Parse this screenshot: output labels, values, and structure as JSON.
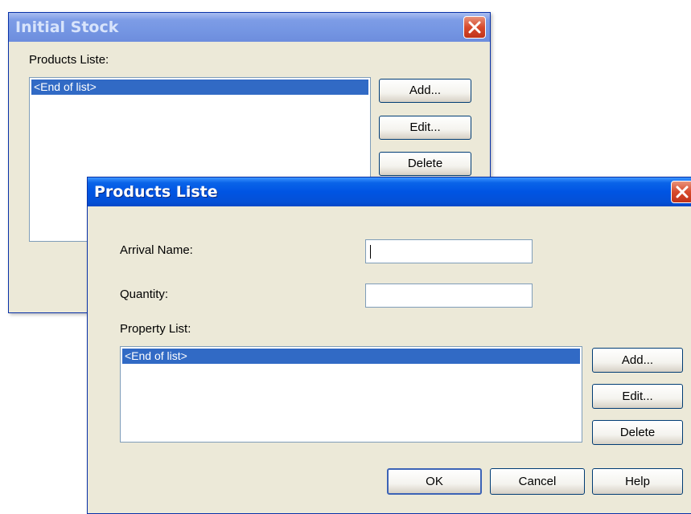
{
  "back_window": {
    "title": "Initial Stock",
    "products_label": "Products Liste:",
    "list_items": [
      "<End of list>"
    ],
    "buttons": {
      "add": "Add...",
      "edit": "Edit...",
      "delete": "Delete"
    }
  },
  "front_window": {
    "title": "Products Liste",
    "arrival_name_label": "Arrival Name:",
    "arrival_name_value": "",
    "quantity_label": "Quantity:",
    "quantity_value": "",
    "property_list_label": "Property List:",
    "list_items": [
      "<End of list>"
    ],
    "buttons": {
      "add": "Add...",
      "edit": "Edit...",
      "delete": "Delete",
      "ok": "OK",
      "cancel": "Cancel",
      "help": "Help"
    }
  },
  "colors": {
    "titlebar_active": "#0054e3",
    "titlebar_inactive": "#7596e3",
    "selection": "#316ac5",
    "dialog_face": "#ece9d8",
    "close_button": "#d74a2c"
  },
  "icons": {
    "close": "close-icon"
  }
}
